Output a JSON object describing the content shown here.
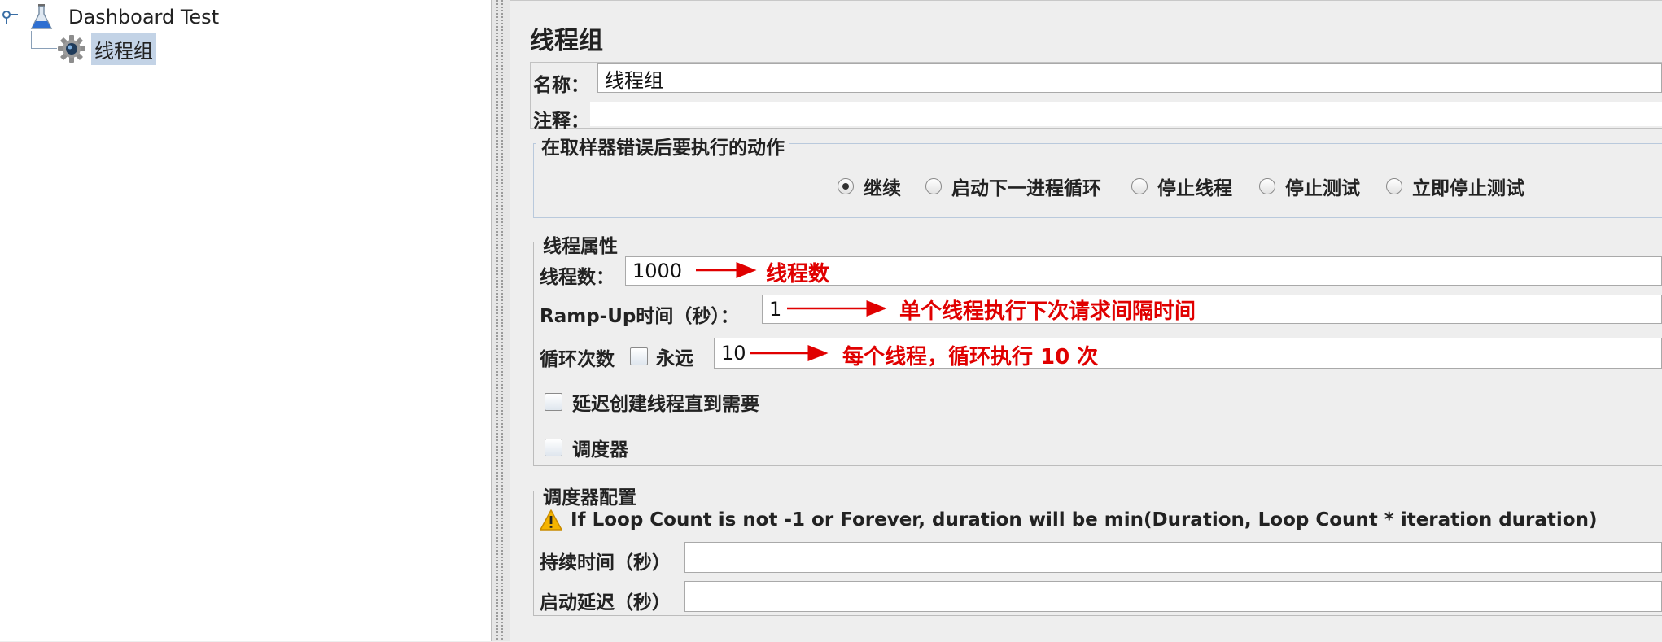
{
  "tree": {
    "root_label": "Dashboard Test",
    "child_label": "线程组"
  },
  "panel": {
    "title": "线程组",
    "name_label": "名称：",
    "name_value": "线程组",
    "comment_label": "注释：",
    "comment_value": "",
    "on_error": {
      "legend": "在取样器错误后要执行的动作",
      "options": [
        "继续",
        "启动下一进程循环",
        "停止线程",
        "停止测试",
        "立即停止测试"
      ],
      "selected": "继续"
    },
    "thread_props": {
      "legend": "线程属性",
      "threads_label": "线程数：",
      "threads_value": "1000",
      "rampup_label": "Ramp-Up时间（秒）：",
      "rampup_value": "1",
      "loop_label": "循环次数",
      "forever_label": "永远",
      "forever_checked": false,
      "loop_value": "10",
      "delay_label": "延迟创建线程直到需要",
      "delay_checked": false,
      "scheduler_label": "调度器",
      "scheduler_checked": false
    },
    "scheduler_config": {
      "legend": "调度器配置",
      "warning": "If Loop Count is not -1 or Forever, duration will be min(Duration, Loop Count * iteration duration)",
      "duration_label": "持续时间（秒）",
      "duration_value": "",
      "startup_delay_label": "启动延迟（秒）",
      "startup_delay_value": ""
    }
  },
  "annotations": {
    "threads": "线程数",
    "rampup": "单个线程执行下次请求间隔时间",
    "loop": "每个线程，循环执行 10 次",
    "color": "#e00000"
  },
  "icons": {
    "root": "flask-icon",
    "child": "gear-icon",
    "tree_handle": "tree-handle-icon",
    "warning": "warning-icon"
  }
}
